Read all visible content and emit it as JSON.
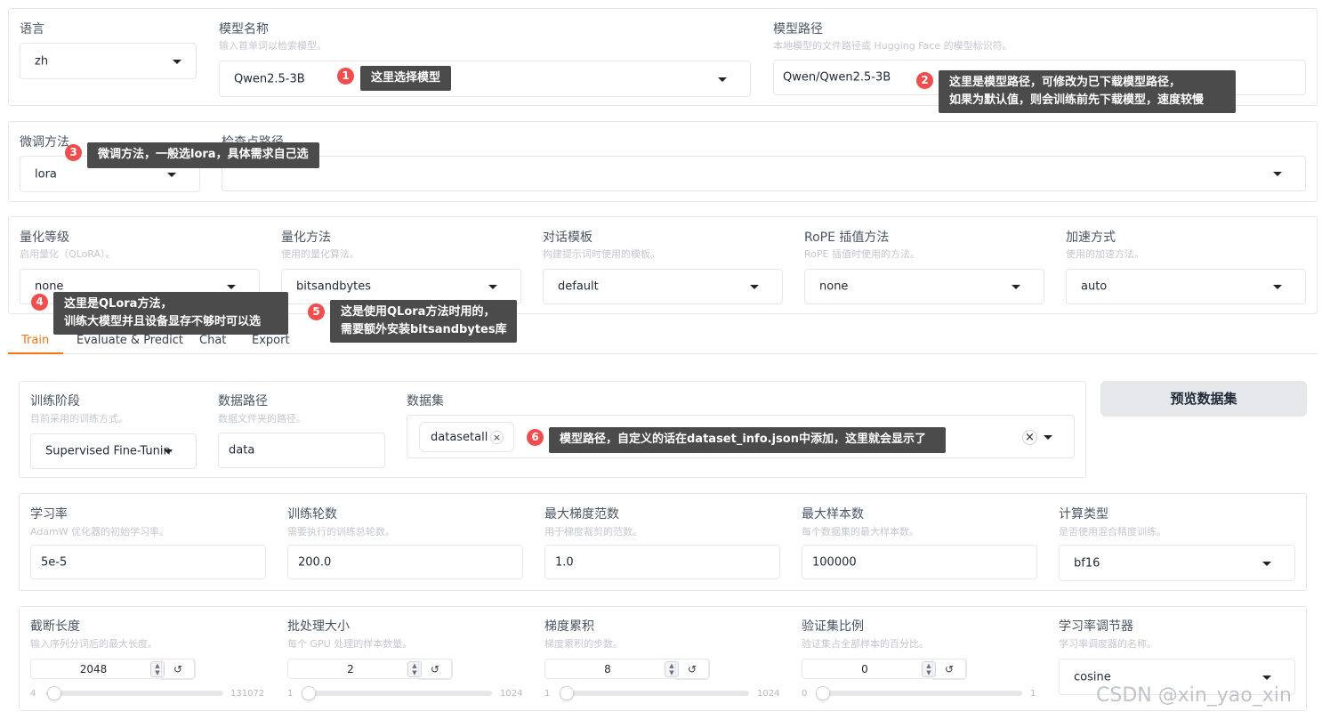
{
  "top": {
    "language": {
      "label": "语言",
      "value": "zh"
    },
    "model_name": {
      "label": "模型名称",
      "hint": "输入首单词以检索模型。",
      "value": "Qwen2.5-3B"
    },
    "model_path": {
      "label": "模型路径",
      "hint": "本地模型的文件路径或 Hugging Face 的模型标识符。",
      "value": "Qwen/Qwen2.5-3B"
    }
  },
  "finetune": {
    "method": {
      "label": "微调方法",
      "value": "lora"
    },
    "checkpoint": {
      "label": "检查点路径",
      "value": ""
    }
  },
  "advanced": {
    "quant_bit": {
      "label": "量化等级",
      "hint": "启用量化（QLoRA）。",
      "value": "none"
    },
    "quant_method": {
      "label": "量化方法",
      "hint": "使用的量化算法。",
      "value": "bitsandbytes"
    },
    "template": {
      "label": "对话模板",
      "hint": "构建提示词时使用的模板。",
      "value": "default"
    },
    "rope": {
      "label": "RoPE 插值方法",
      "hint": "RoPE 插值时使用的方法。",
      "value": "none"
    },
    "booster": {
      "label": "加速方式",
      "hint": "使用的加速方法。",
      "value": "auto"
    }
  },
  "tabs": [
    "Train",
    "Evaluate & Predict",
    "Chat",
    "Export"
  ],
  "train": {
    "stage": {
      "label": "训练阶段",
      "hint": "目前采用的训练方式。",
      "value": "Supervised Fine-Tuning"
    },
    "dataset_dir": {
      "label": "数据路径",
      "hint": "数据文件夹的路径。",
      "value": "data"
    },
    "dataset": {
      "label": "数据集",
      "chip": "datasetall",
      "chip_close": "×",
      "clear": "×"
    },
    "preview_button": "预览数据集"
  },
  "params": {
    "lr": {
      "label": "学习率",
      "hint": "AdamW 优化器的初始学习率。",
      "value": "5e-5"
    },
    "epochs": {
      "label": "训练轮数",
      "hint": "需要执行的训练总轮数。",
      "value": "200.0"
    },
    "max_grad_norm": {
      "label": "最大梯度范数",
      "hint": "用于梯度裁剪的范数。",
      "value": "1.0"
    },
    "max_samples": {
      "label": "最大样本数",
      "hint": "每个数据集的最大样本数。",
      "value": "100000"
    },
    "compute_type": {
      "label": "计算类型",
      "hint": "是否使用混合精度训练。",
      "value": "bf16"
    }
  },
  "sliders": {
    "cutoff": {
      "label": "截断长度",
      "hint": "输入序列分词后的最大长度。",
      "value": "2048",
      "min": "4",
      "max": "131072",
      "fraction": 0.0156
    },
    "batch": {
      "label": "批处理大小",
      "hint": "每个 GPU 处理的样本数量。",
      "value": "2",
      "min": "1",
      "max": "1024",
      "fraction": 0.001
    },
    "grad_acc": {
      "label": "梯度累积",
      "hint": "梯度累积的步数。",
      "value": "8",
      "min": "1",
      "max": "1024",
      "fraction": 0.007
    },
    "val_size": {
      "label": "验证集比例",
      "hint": "验证集占全部样本的百分比。",
      "value": "0",
      "min": "0",
      "max": "1",
      "fraction": 0
    },
    "scheduler": {
      "label": "学习率调节器",
      "hint": "学习率调度器的名称。",
      "value": "cosine"
    }
  },
  "annotations": {
    "a1": {
      "num": "1",
      "text": "这里选择模型"
    },
    "a2": {
      "num": "2",
      "line1": "这里是模型路径，可修改为已下载模型路径，",
      "line2": "如果为默认值，则会训练前先下载模型，速度较慢"
    },
    "a3": {
      "num": "3",
      "text": "微调方法，一般选lora，具体需求自己选"
    },
    "a4": {
      "num": "4",
      "line1": "这里是QLora方法，",
      "line2": "训练大模型并且设备显存不够时可以选"
    },
    "a5": {
      "num": "5",
      "line1": "这是使用QLora方法时用的，",
      "line2": "需要额外安装bitsandbytes库"
    },
    "a6": {
      "num": "6",
      "text": "模型路径，自定义的话在dataset_info.json中添加，这里就会显示了"
    }
  },
  "watermark": "CSDN @xin_yao_xin",
  "colors": {
    "accent": "#f97316",
    "badge": "#f04e4e",
    "tooltip": "#4b4b4b"
  }
}
